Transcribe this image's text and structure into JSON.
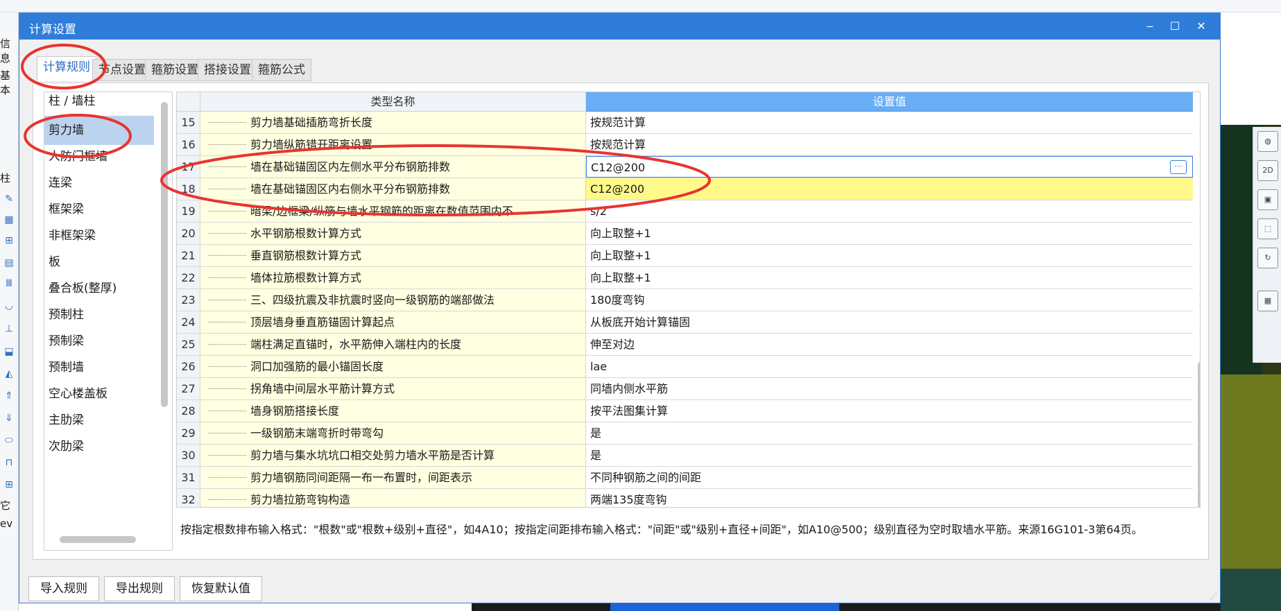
{
  "dialog": {
    "title": "计算设置",
    "minimize_icon": "minimize-icon",
    "maximize_icon": "maximize-icon",
    "close_icon": "close-icon"
  },
  "background": {
    "left_partial_labels": [
      "信息",
      "基本",
      "柱",
      "它",
      "ev"
    ]
  },
  "tabs": [
    {
      "label": "计算规则",
      "active": true
    },
    {
      "label": "节点设置",
      "active": false
    },
    {
      "label": "箍筋设置",
      "active": false
    },
    {
      "label": "搭接设置",
      "active": false
    },
    {
      "label": "箍筋公式",
      "active": false
    }
  ],
  "categories": [
    {
      "label": "柱 / 墙柱"
    },
    {
      "label": "剪力墙"
    },
    {
      "label": "人防门框墙"
    },
    {
      "label": "连梁"
    },
    {
      "label": "框架梁"
    },
    {
      "label": "非框架梁"
    },
    {
      "label": "板"
    },
    {
      "label": "叠合板(整厚)"
    },
    {
      "label": "预制柱"
    },
    {
      "label": "预制梁"
    },
    {
      "label": "预制墙"
    },
    {
      "label": "空心楼盖板"
    },
    {
      "label": "主肋梁"
    },
    {
      "label": "次肋梁"
    }
  ],
  "selected_category": "剪力墙",
  "grid": {
    "header_name": "类型名称",
    "header_value": "设置值",
    "rows": [
      {
        "num": "15",
        "name": "剪力墙基础插筋弯折长度",
        "value": "按规范计算"
      },
      {
        "num": "16",
        "name": "剪力墙纵筋错开距离设置",
        "value": "按规范计算"
      },
      {
        "num": "17",
        "name": "墙在基础锚固区内左侧水平分布钢筋排数",
        "value": "C12@200"
      },
      {
        "num": "18",
        "name": "墙在基础锚固区内右侧水平分布钢筋排数",
        "value": "C12@200"
      },
      {
        "num": "19",
        "name": "暗梁/边框梁/纵筋与墙水平钢筋的距离在数值范围内不",
        "value": "s/2"
      },
      {
        "num": "20",
        "name": "水平钢筋根数计算方式",
        "value": "向上取整+1"
      },
      {
        "num": "21",
        "name": "垂直钢筋根数计算方式",
        "value": "向上取整+1"
      },
      {
        "num": "22",
        "name": "墙体拉筋根数计算方式",
        "value": "向上取整+1"
      },
      {
        "num": "23",
        "name": "三、四级抗震及非抗震时竖向一级钢筋的端部做法",
        "value": "180度弯钩"
      },
      {
        "num": "24",
        "name": "顶层墙身垂直筋锚固计算起点",
        "value": "从板底开始计算锚固"
      },
      {
        "num": "25",
        "name": "端柱满足直锚时，水平筋伸入端柱内的长度",
        "value": "伸至对边"
      },
      {
        "num": "26",
        "name": "洞口加强筋的最小锚固长度",
        "value": "lae"
      },
      {
        "num": "27",
        "name": "拐角墙中间层水平筋计算方式",
        "value": "同墙内侧水平筋"
      },
      {
        "num": "28",
        "name": "墙身钢筋搭接长度",
        "value": "按平法图集计算"
      },
      {
        "num": "29",
        "name": "一级钢筋末端弯折时带弯勾",
        "value": "是"
      },
      {
        "num": "30",
        "name": "剪力墙与集水坑坑口相交处剪力墙水平筋是否计算",
        "value": "是"
      },
      {
        "num": "31",
        "name": "剪力墙钢筋同间距隔一布一布置时，间距表示",
        "value": "不同种钢筋之间的间距"
      },
      {
        "num": "32",
        "name": "剪力墙拉筋弯钩构造",
        "value": "两端135度弯钩"
      }
    ],
    "editing_row": "17",
    "highlight_row": "18",
    "ellipsis_label": "···"
  },
  "description": "按指定根数排布输入格式：\"根数\"或\"根数+级别+直径\"，如4A10；按指定间距排布输入格式：\"间距\"或\"级别+直径+间距\"，如A10@500；级别直径为空时取墙水平筋。来源16G101-3第64页。",
  "buttons": {
    "import": "导入规则",
    "export": "导出规则",
    "restore": "恢复默认值"
  },
  "colors": {
    "title_bar": "#2f7dd9",
    "header_value_bg": "#69aef5",
    "name_cell_bg": "#ffffe1",
    "highlight_row": "#fff98a",
    "selected_item": "#bcd3f0",
    "annotation_red": "#e8342f"
  },
  "view_toolbar": {
    "label_2d": "2D"
  }
}
